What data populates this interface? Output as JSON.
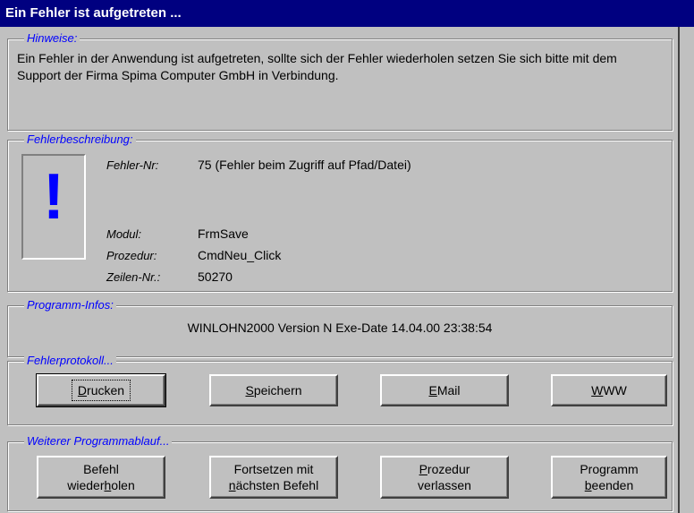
{
  "window": {
    "title": "Ein Fehler ist aufgetreten ..."
  },
  "hinweise": {
    "legend": "Hinweise:",
    "text": "Ein Fehler in der Anwendung  ist aufgetreten, sollte sich der Fehler wiederholen setzen Sie sich bitte mit dem Support der Firma Spima Computer GmbH in Verbindung."
  },
  "fehlerbeschreibung": {
    "legend": "Fehlerbeschreibung:",
    "icon_glyph": "!",
    "fehler_nr_label": "Fehler-Nr:",
    "fehler_nr_value": "75 (Fehler beim Zugriff auf Pfad/Datei)",
    "modul_label": "Modul:",
    "modul_value": "FrmSave",
    "prozedur_label": "Prozedur:",
    "prozedur_value": "CmdNeu_Click",
    "zeilen_label": "Zeilen-Nr.:",
    "zeilen_value": "50270"
  },
  "programm_infos": {
    "legend": "Programm-Infos:",
    "text": "WINLOHN2000 Version N Exe-Date 14.04.00 23:38:54"
  },
  "fehlerprotokoll": {
    "legend": "Fehlerprotokoll...",
    "drucken": {
      "mn": "D",
      "rest": "rucken"
    },
    "speichern": {
      "mn": "S",
      "rest": "peichern"
    },
    "email": {
      "mn": "E",
      "rest": "Mail"
    },
    "www": {
      "mn": "W",
      "rest": "WW"
    }
  },
  "ablauf": {
    "legend": "Weiterer Programmablauf...",
    "befehl": {
      "line1": "Befehl",
      "line2_pre": "wieder",
      "line2_mn": "h",
      "line2_post": "olen"
    },
    "fortsetzen": {
      "line1": "Fortsetzen mit",
      "line2_mn": "n",
      "line2_post": "ächsten Befehl"
    },
    "prozedur": {
      "line1_mn": "P",
      "line1_post": "rozedur",
      "line2": "verlassen"
    },
    "programm": {
      "line1": "Programm",
      "line2_mn": "b",
      "line2_post": "eenden"
    }
  }
}
